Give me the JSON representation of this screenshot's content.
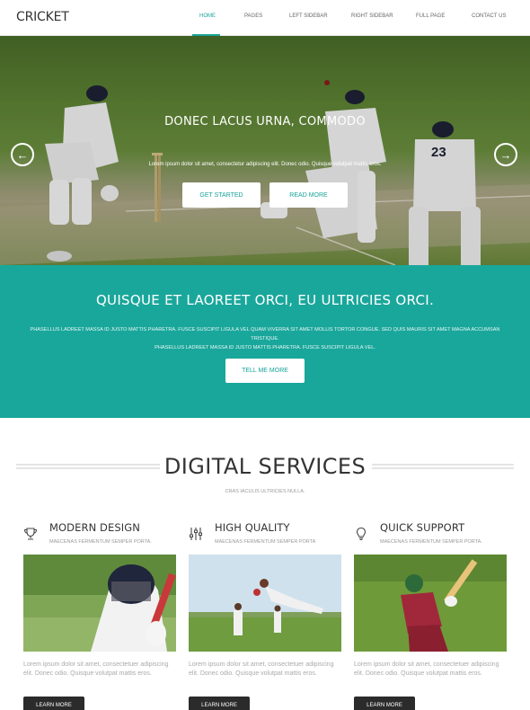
{
  "header": {
    "logo": "CRICKET",
    "nav": [
      {
        "label": "HOME",
        "active": true
      },
      {
        "label": "PAGES",
        "active": false
      },
      {
        "label": "LEFT SIDEBAR",
        "active": false
      },
      {
        "label": "RIGHT SIDEBAR",
        "active": false
      },
      {
        "label": "FULL PAGE",
        "active": false
      },
      {
        "label": "CONTACT US",
        "active": false
      }
    ]
  },
  "hero": {
    "title": "DONEC LACUS URNA, COMMODO",
    "subtitle": "Lorem ipsum dolor sit amet, consectetur adipiscing elit. Donec odio. Quisque volutpat mattis eros.",
    "primary_button": "GET STARTED",
    "secondary_button": "READ MORE",
    "player_number": "23",
    "prev_icon": "arrow-left-icon",
    "next_icon": "arrow-right-icon"
  },
  "intro": {
    "title": "QUISQUE ET LAOREET ORCI, EU ULTRICIES ORCI.",
    "text_line1": "PHASELLUS LADREET MASSA ID JUSTO MATTIS PHARETRA. FUSCE SUSCIPIT LIGULA VEL QUAM VIVERRA SIT AMET MOLLIS TORTOR CONGUE. SED QUIS MAURIS SIT AMET MAGNA ACCUMSAN TRISTIQUE.",
    "text_line2": "PHASELLUS LADREET MASSA ID JUSTO MATTIS PHARETRA. FUSCE SUSCIPIT LIGULA VEL.",
    "button": "TELL ME MORE"
  },
  "services": {
    "title": "DIGITAL SERVICES",
    "subtitle": "CRAS IACULIS ULTRICIES NULLA.",
    "items": [
      {
        "icon": "trophy-icon",
        "title": "MODERN DESIGN",
        "subtitle": "MAECENAS FERMENTUM SEMPER PORTA.",
        "text": "Lorem ipsum dolor sit amet, consectetuer adipiscing elit. Donec odio. Quisque volutpat mattis eros.",
        "button": "LEARN MORE"
      },
      {
        "icon": "sliders-icon",
        "title": "HIGH QUALITY",
        "subtitle": "MAECENAS FERMENTUM SEMPER PORTA",
        "text": "Lorem ipsum dolor sit amet, consectetuer adipiscing elit. Donec odio. Quisque volutpat mattis eros.",
        "button": "LEARN MORE"
      },
      {
        "icon": "lightbulb-icon",
        "title": "QUICK SUPPORT",
        "subtitle": "MAECENAS FERMENTUM SEMPER PORTA.",
        "text": "Lorem ipsum dolor sit amet, consectetuer adipiscing elit. Donec odio. Quisque volutpat mattis eros.",
        "button": "LEARN MORE"
      }
    ]
  },
  "colors": {
    "accent": "#1aa79b",
    "dark_button": "#2b2b2b"
  }
}
